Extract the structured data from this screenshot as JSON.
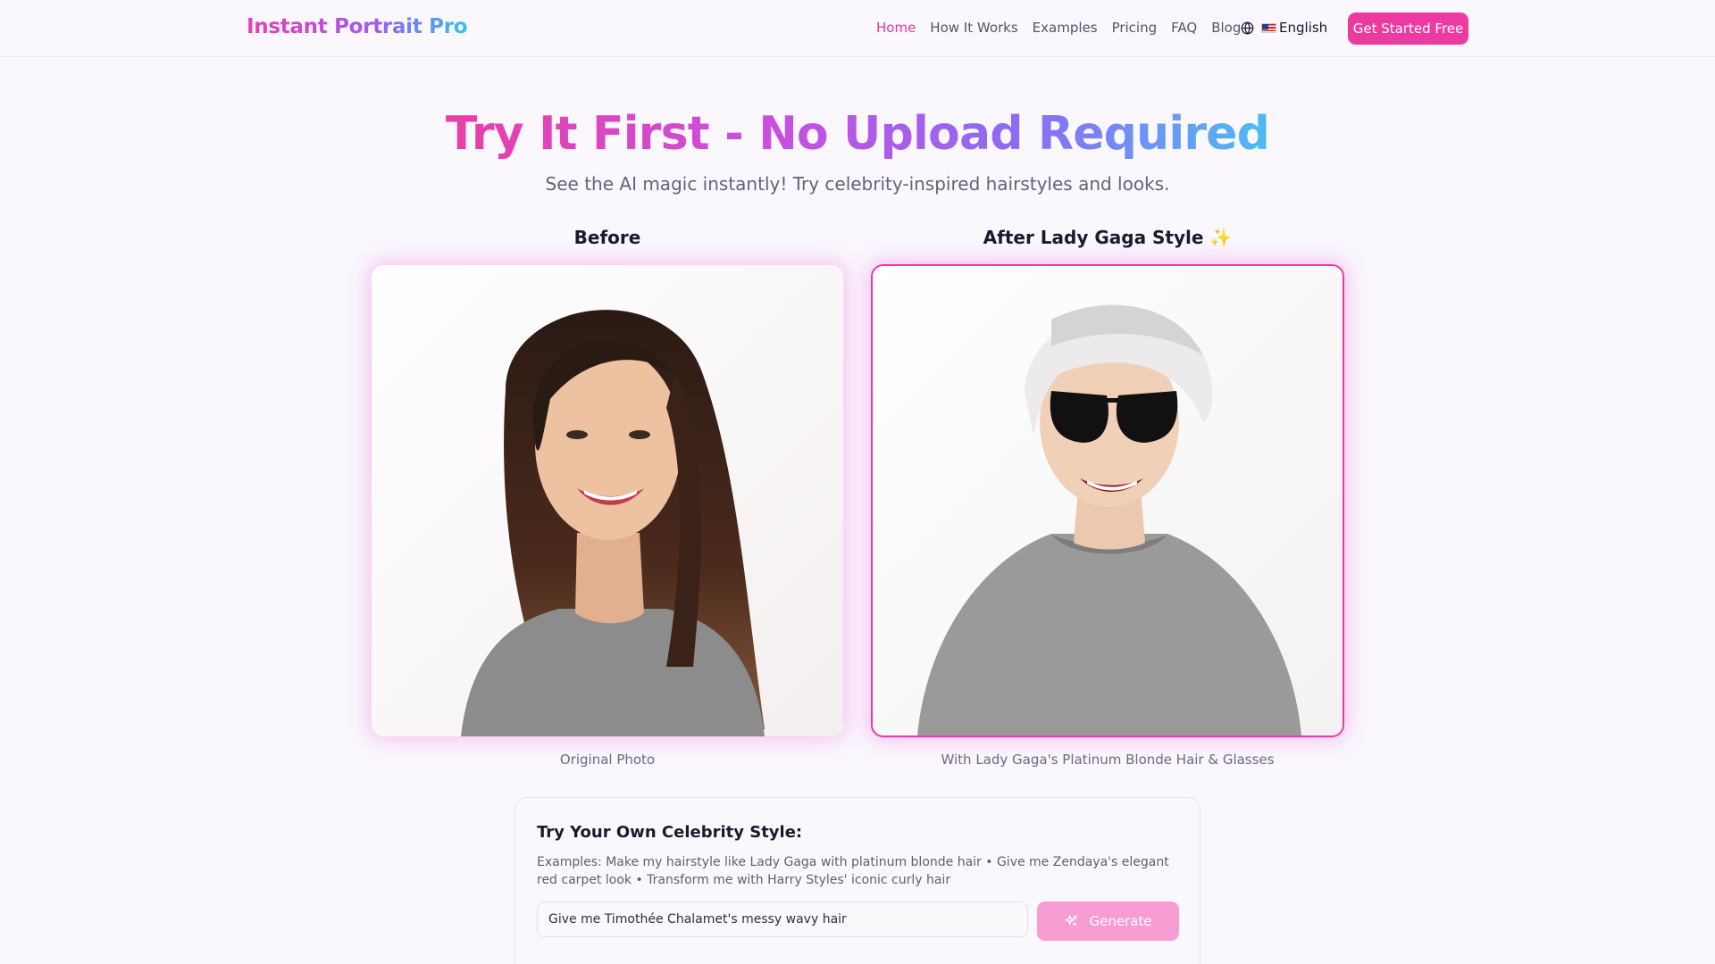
{
  "header": {
    "logo": "Instant Portrait Pro",
    "nav": [
      "Home",
      "How It Works",
      "Examples",
      "Pricing",
      "FAQ",
      "Blog"
    ],
    "active_nav": "Home",
    "language": "English",
    "language_icon": "globe-icon",
    "cta": "Get Started Free"
  },
  "hero": {
    "title": "Try It First - No Upload Required",
    "subtitle": "See the AI magic instantly! Try celebrity-inspired hairstyles and looks."
  },
  "comparison": {
    "before_label": "Before",
    "after_label": "After Lady Gaga Style ✨",
    "before_caption": "Original Photo",
    "after_caption": "With Lady Gaga's Platinum Blonde Hair & Glasses"
  },
  "try_panel": {
    "title": "Try Your Own Celebrity Style:",
    "examples": "Examples: Make my hairstyle like Lady Gaga with platinum blonde hair • Give me Zendaya's elegant red carpet look • Transform me with Harry Styles' iconic curly hair",
    "input_value": "Give me Timothée Chalamet's messy wavy hair",
    "generate_label": "Generate",
    "generate_icon": "sparkles-icon"
  },
  "colors": {
    "accent": "#ec3aa0",
    "accent_light": "#f79dd3",
    "background": "#faf7fd"
  }
}
